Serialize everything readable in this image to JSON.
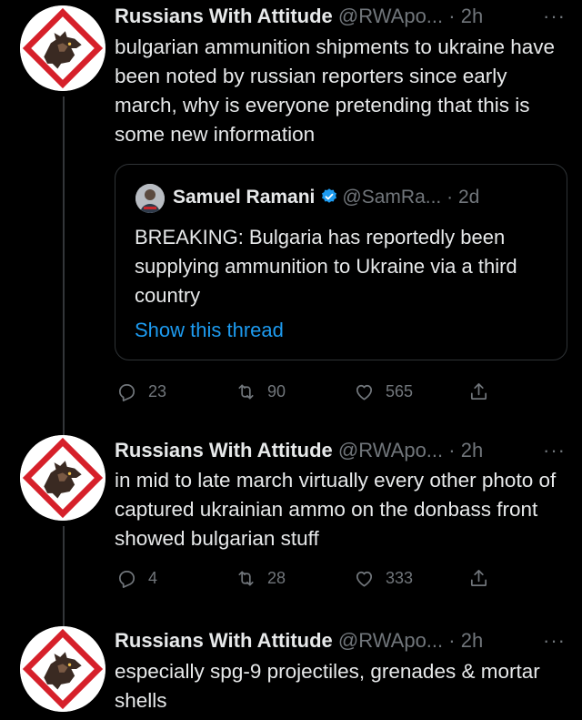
{
  "tweets": [
    {
      "author": "Russians With Attitude",
      "handle": "@RWApo...",
      "separator": "·",
      "time": "2h",
      "more": "···",
      "text": "bulgarian ammunition shipments to ukraine have been noted by russian reporters since early march, why is everyone pretending that this is some new information",
      "quote": {
        "author": "Samuel Ramani",
        "handle": "@SamRa...",
        "separator": "·",
        "time": "2d",
        "text": "BREAKING: Bulgaria has reportedly been supplying ammunition to Ukraine via a third country",
        "link": "Show this thread"
      },
      "replies": "23",
      "retweets": "90",
      "likes": "565"
    },
    {
      "author": "Russians With Attitude",
      "handle": "@RWApo...",
      "separator": "·",
      "time": "2h",
      "more": "···",
      "text": "in mid to late march virtually every other photo of captured ukrainian ammo on the donbass front showed bulgarian stuff",
      "replies": "4",
      "retweets": "28",
      "likes": "333"
    },
    {
      "author": "Russians With Attitude",
      "handle": "@RWApo...",
      "separator": "·",
      "time": "2h",
      "more": "···",
      "text": "especially spg-9 projectiles, grenades & mortar shells"
    }
  ],
  "icons": {
    "reply": "reply-icon",
    "retweet": "retweet-icon",
    "like": "heart-icon",
    "share": "share-icon",
    "verified": "verified-badge-icon"
  },
  "colors": {
    "background": "#000000",
    "text": "#e7e9ea",
    "muted": "#71767b",
    "link": "#1d9bf0",
    "verified": "#1d9bf0",
    "logo_red": "#d6202a"
  }
}
